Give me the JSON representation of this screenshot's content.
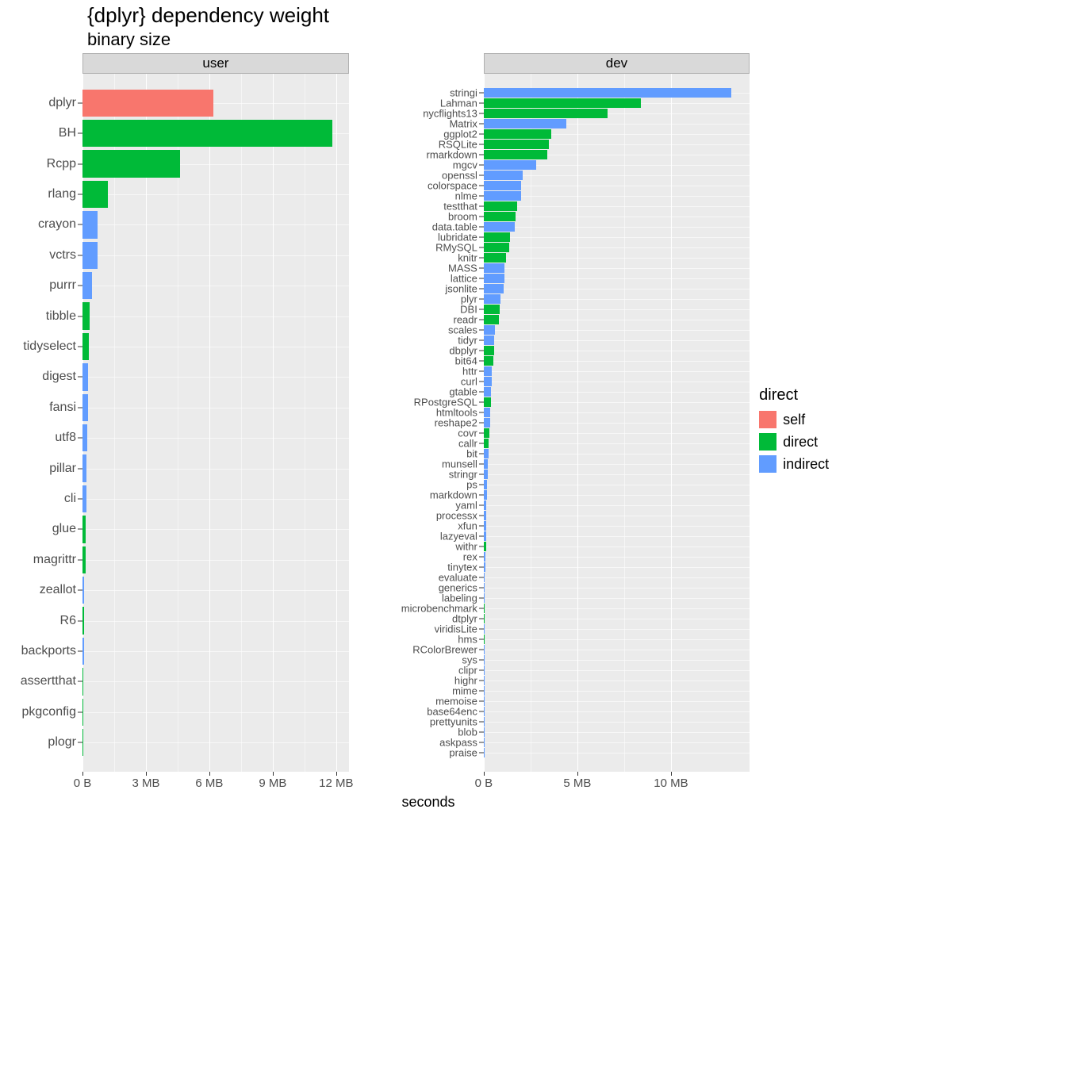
{
  "title": "{dplyr} dependency weight",
  "subtitle": "binary size",
  "xlabel": "seconds",
  "legend": {
    "title": "direct",
    "items": [
      {
        "label": "self",
        "color": "#F8766D"
      },
      {
        "label": "direct",
        "color": "#00BA38"
      },
      {
        "label": "indirect",
        "color": "#619CFF"
      }
    ]
  },
  "chart_data": [
    {
      "facet": "user",
      "type": "bar",
      "orientation": "horizontal",
      "xlabel": "",
      "xlim_mb": [
        0,
        12.6
      ],
      "xticks_mb": [
        0,
        3,
        6,
        9,
        12
      ],
      "xtick_labels": [
        "0 B",
        "3 MB",
        "6 MB",
        "9 MB",
        "12 MB"
      ],
      "bars": [
        {
          "name": "dplyr",
          "value_mb": 6.2,
          "group": "self"
        },
        {
          "name": "BH",
          "value_mb": 11.8,
          "group": "direct"
        },
        {
          "name": "Rcpp",
          "value_mb": 4.6,
          "group": "direct"
        },
        {
          "name": "rlang",
          "value_mb": 1.2,
          "group": "direct"
        },
        {
          "name": "crayon",
          "value_mb": 0.7,
          "group": "indirect"
        },
        {
          "name": "vctrs",
          "value_mb": 0.7,
          "group": "indirect"
        },
        {
          "name": "purrr",
          "value_mb": 0.45,
          "group": "indirect"
        },
        {
          "name": "tibble",
          "value_mb": 0.35,
          "group": "direct"
        },
        {
          "name": "tidyselect",
          "value_mb": 0.3,
          "group": "direct"
        },
        {
          "name": "digest",
          "value_mb": 0.25,
          "group": "indirect"
        },
        {
          "name": "fansi",
          "value_mb": 0.25,
          "group": "indirect"
        },
        {
          "name": "utf8",
          "value_mb": 0.22,
          "group": "indirect"
        },
        {
          "name": "pillar",
          "value_mb": 0.18,
          "group": "indirect"
        },
        {
          "name": "cli",
          "value_mb": 0.18,
          "group": "indirect"
        },
        {
          "name": "glue",
          "value_mb": 0.15,
          "group": "direct"
        },
        {
          "name": "magrittr",
          "value_mb": 0.15,
          "group": "direct"
        },
        {
          "name": "zeallot",
          "value_mb": 0.06,
          "group": "indirect"
        },
        {
          "name": "R6",
          "value_mb": 0.06,
          "group": "direct"
        },
        {
          "name": "backports",
          "value_mb": 0.06,
          "group": "indirect"
        },
        {
          "name": "assertthat",
          "value_mb": 0.05,
          "group": "direct"
        },
        {
          "name": "pkgconfig",
          "value_mb": 0.02,
          "group": "direct"
        },
        {
          "name": "plogr",
          "value_mb": 0.01,
          "group": "direct"
        }
      ]
    },
    {
      "facet": "dev",
      "type": "bar",
      "orientation": "horizontal",
      "xlabel": "",
      "xlim_mb": [
        0,
        14.2
      ],
      "xticks_mb": [
        0,
        5,
        10
      ],
      "xtick_labels": [
        "0 B",
        "5 MB",
        "10 MB"
      ],
      "bars": [
        {
          "name": "stringi",
          "value_mb": 13.2,
          "group": "indirect"
        },
        {
          "name": "Lahman",
          "value_mb": 8.4,
          "group": "direct"
        },
        {
          "name": "nycflights13",
          "value_mb": 6.6,
          "group": "direct"
        },
        {
          "name": "Matrix",
          "value_mb": 4.4,
          "group": "indirect"
        },
        {
          "name": "ggplot2",
          "value_mb": 3.6,
          "group": "direct"
        },
        {
          "name": "RSQLite",
          "value_mb": 3.5,
          "group": "direct"
        },
        {
          "name": "rmarkdown",
          "value_mb": 3.4,
          "group": "direct"
        },
        {
          "name": "mgcv",
          "value_mb": 2.8,
          "group": "indirect"
        },
        {
          "name": "openssl",
          "value_mb": 2.1,
          "group": "indirect"
        },
        {
          "name": "colorspace",
          "value_mb": 2.0,
          "group": "indirect"
        },
        {
          "name": "nlme",
          "value_mb": 2.0,
          "group": "indirect"
        },
        {
          "name": "testthat",
          "value_mb": 1.8,
          "group": "direct"
        },
        {
          "name": "broom",
          "value_mb": 1.7,
          "group": "direct"
        },
        {
          "name": "data.table",
          "value_mb": 1.65,
          "group": "indirect"
        },
        {
          "name": "lubridate",
          "value_mb": 1.4,
          "group": "direct"
        },
        {
          "name": "RMySQL",
          "value_mb": 1.35,
          "group": "direct"
        },
        {
          "name": "knitr",
          "value_mb": 1.2,
          "group": "direct"
        },
        {
          "name": "MASS",
          "value_mb": 1.1,
          "group": "indirect"
        },
        {
          "name": "lattice",
          "value_mb": 1.1,
          "group": "indirect"
        },
        {
          "name": "jsonlite",
          "value_mb": 1.05,
          "group": "indirect"
        },
        {
          "name": "plyr",
          "value_mb": 0.9,
          "group": "indirect"
        },
        {
          "name": "DBI",
          "value_mb": 0.85,
          "group": "direct"
        },
        {
          "name": "readr",
          "value_mb": 0.8,
          "group": "direct"
        },
        {
          "name": "scales",
          "value_mb": 0.6,
          "group": "indirect"
        },
        {
          "name": "tidyr",
          "value_mb": 0.55,
          "group": "indirect"
        },
        {
          "name": "dbplyr",
          "value_mb": 0.55,
          "group": "direct"
        },
        {
          "name": "bit64",
          "value_mb": 0.5,
          "group": "direct"
        },
        {
          "name": "httr",
          "value_mb": 0.45,
          "group": "indirect"
        },
        {
          "name": "curl",
          "value_mb": 0.45,
          "group": "indirect"
        },
        {
          "name": "gtable",
          "value_mb": 0.4,
          "group": "indirect"
        },
        {
          "name": "RPostgreSQL",
          "value_mb": 0.4,
          "group": "direct"
        },
        {
          "name": "htmltools",
          "value_mb": 0.35,
          "group": "indirect"
        },
        {
          "name": "reshape2",
          "value_mb": 0.35,
          "group": "indirect"
        },
        {
          "name": "covr",
          "value_mb": 0.3,
          "group": "direct"
        },
        {
          "name": "callr",
          "value_mb": 0.28,
          "group": "direct"
        },
        {
          "name": "bit",
          "value_mb": 0.25,
          "group": "indirect"
        },
        {
          "name": "munsell",
          "value_mb": 0.2,
          "group": "indirect"
        },
        {
          "name": "stringr",
          "value_mb": 0.2,
          "group": "indirect"
        },
        {
          "name": "ps",
          "value_mb": 0.18,
          "group": "indirect"
        },
        {
          "name": "markdown",
          "value_mb": 0.18,
          "group": "indirect"
        },
        {
          "name": "yaml",
          "value_mb": 0.15,
          "group": "indirect"
        },
        {
          "name": "processx",
          "value_mb": 0.15,
          "group": "indirect"
        },
        {
          "name": "xfun",
          "value_mb": 0.12,
          "group": "indirect"
        },
        {
          "name": "lazyeval",
          "value_mb": 0.12,
          "group": "indirect"
        },
        {
          "name": "withr",
          "value_mb": 0.12,
          "group": "direct"
        },
        {
          "name": "rex",
          "value_mb": 0.08,
          "group": "indirect"
        },
        {
          "name": "tinytex",
          "value_mb": 0.08,
          "group": "indirect"
        },
        {
          "name": "evaluate",
          "value_mb": 0.06,
          "group": "indirect"
        },
        {
          "name": "generics",
          "value_mb": 0.06,
          "group": "indirect"
        },
        {
          "name": "labeling",
          "value_mb": 0.06,
          "group": "indirect"
        },
        {
          "name": "microbenchmark",
          "value_mb": 0.06,
          "group": "direct"
        },
        {
          "name": "dtplyr",
          "value_mb": 0.05,
          "group": "direct"
        },
        {
          "name": "viridisLite",
          "value_mb": 0.05,
          "group": "indirect"
        },
        {
          "name": "hms",
          "value_mb": 0.05,
          "group": "direct"
        },
        {
          "name": "RColorBrewer",
          "value_mb": 0.04,
          "group": "indirect"
        },
        {
          "name": "sys",
          "value_mb": 0.04,
          "group": "indirect"
        },
        {
          "name": "clipr",
          "value_mb": 0.04,
          "group": "indirect"
        },
        {
          "name": "highr",
          "value_mb": 0.04,
          "group": "indirect"
        },
        {
          "name": "mime",
          "value_mb": 0.04,
          "group": "indirect"
        },
        {
          "name": "memoise",
          "value_mb": 0.03,
          "group": "indirect"
        },
        {
          "name": "base64enc",
          "value_mb": 0.03,
          "group": "indirect"
        },
        {
          "name": "prettyunits",
          "value_mb": 0.03,
          "group": "indirect"
        },
        {
          "name": "blob",
          "value_mb": 0.03,
          "group": "indirect"
        },
        {
          "name": "askpass",
          "value_mb": 0.02,
          "group": "indirect"
        },
        {
          "name": "praise",
          "value_mb": 0.02,
          "group": "indirect"
        }
      ]
    }
  ]
}
